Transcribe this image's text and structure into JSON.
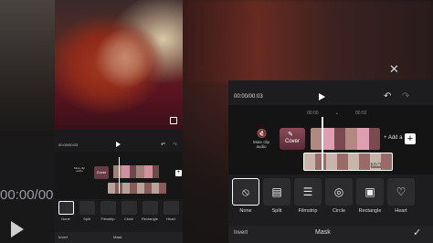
{
  "background": {
    "left_timecode": "00:00/00",
    "close_glyph": "✕"
  },
  "small_editor": {
    "timecode": "00:00/00:03",
    "undo_icon": "↶",
    "redo_icon": "↷",
    "mute_label": "Mute clip audio",
    "cover_label": "Cover",
    "add_label": "+",
    "tools": [
      {
        "label": "None"
      },
      {
        "label": "Split"
      },
      {
        "label": "Filmstrip"
      },
      {
        "label": "Circle"
      },
      {
        "label": "Rectangle"
      },
      {
        "label": "Heart"
      }
    ],
    "invert_label": "Invert",
    "mask_label": "Mask"
  },
  "zoomed_editor": {
    "timecode": "00:00/00:03",
    "undo_icon": "↶",
    "redo_icon": "↷",
    "time_marker_0": "00:00",
    "time_marker_dot": "•",
    "time_marker_2": "00:02",
    "mute_icon": "🔇",
    "mute_label": "Mute clip audio",
    "cover_label": "Cover",
    "cover_icon": "✎",
    "add_audio_label": "+ Add a",
    "add_button": "+",
    "clip_duration": "3.0s",
    "tools": [
      {
        "label": "None",
        "glyph": "⦸",
        "active": true
      },
      {
        "label": "Split",
        "glyph": "▤",
        "active": false
      },
      {
        "label": "Filmstrip",
        "glyph": "☰",
        "active": false
      },
      {
        "label": "Circle",
        "glyph": "◎",
        "active": false
      },
      {
        "label": "Rectangle",
        "glyph": "▣",
        "active": false
      },
      {
        "label": "Heart",
        "glyph": "♡",
        "active": false
      }
    ],
    "invert_label": "Invert",
    "mask_label": "Mask",
    "confirm_icon": "✓"
  }
}
